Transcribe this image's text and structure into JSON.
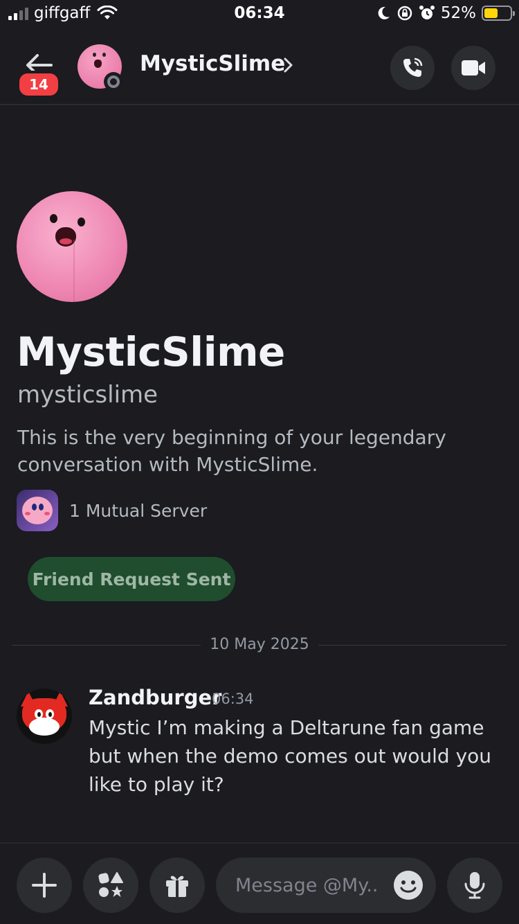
{
  "status_bar": {
    "carrier": "giffgaff",
    "time": "06:34",
    "battery_pct": "52%",
    "battery_level": 0.52,
    "battery_color": "#ffd60a"
  },
  "header": {
    "title": "MysticSlime",
    "unread_badge": "14",
    "back_icon": "arrow-left-icon",
    "call_icon": "phone-call-icon",
    "video_icon": "video-camera-icon",
    "status": "offline"
  },
  "profile": {
    "display_name": "MysticSlime",
    "username": "mysticslime",
    "intro": "This is the very beginning of your legendary conversation with MysticSlime.",
    "mutual_servers": "1 Mutual Server",
    "friend_button": "Friend Request Sent"
  },
  "divider": {
    "date": "10 May 2025"
  },
  "messages": [
    {
      "author": "Zandburger",
      "time": "06:34",
      "text": "Mystic I’m making a Deltarune fan game but when the demo comes out would you like to play it?"
    }
  ],
  "composer": {
    "placeholder": "Message @My..",
    "plus_icon": "plus-icon",
    "apps_icon": "apps-icon",
    "gift_icon": "gift-icon",
    "emoji_icon": "emoji-icon",
    "mic_icon": "microphone-icon"
  },
  "colors": {
    "background": "#1b1b20",
    "badge": "#f23f43",
    "friend_button_bg": "#1f4d2e",
    "button_bg": "#2b2d31"
  }
}
